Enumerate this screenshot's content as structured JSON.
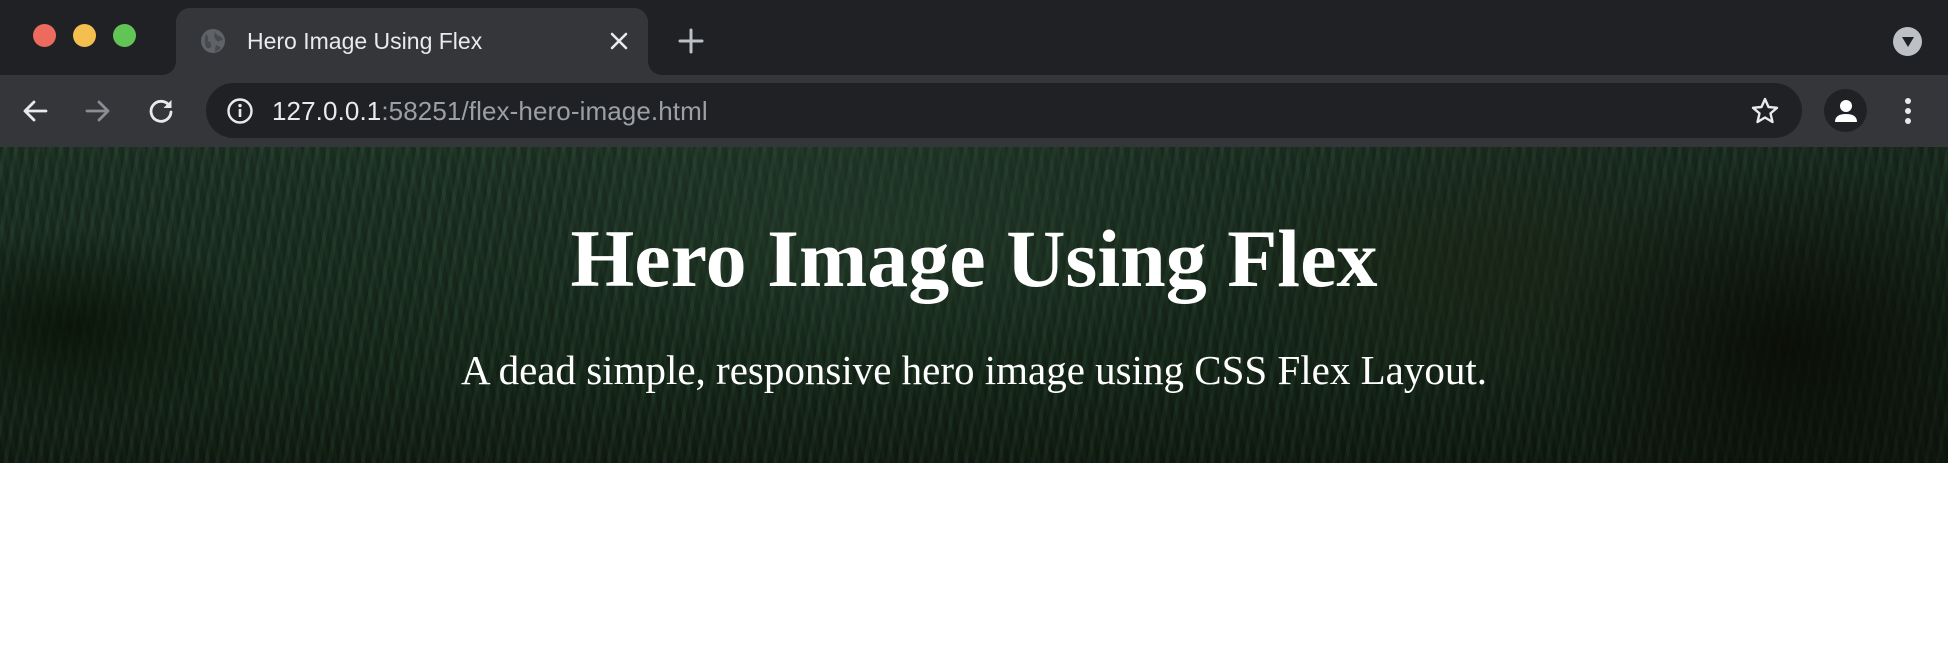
{
  "window": {
    "controls": [
      "close",
      "minimize",
      "maximize"
    ]
  },
  "tabs": [
    {
      "title": "Hero Image Using Flex",
      "favicon": "globe-icon",
      "active": true
    }
  ],
  "toolbar": {
    "url_host": "127.0.0.1",
    "url_rest": ":58251/flex-hero-image.html",
    "icons": {
      "back": "arrow-left-icon",
      "forward": "arrow-right-icon",
      "reload": "reload-icon",
      "info": "info-icon",
      "bookmark": "star-icon",
      "profile": "person-icon",
      "menu": "kebab-menu-icon"
    }
  },
  "page": {
    "hero": {
      "title": "Hero Image Using Flex",
      "subtitle": "A dead simple, responsive hero image using CSS Flex Layout."
    }
  },
  "colors": {
    "titlebar": "#202124",
    "toolbar": "#35363a",
    "omnibox": "#202124",
    "close_red": "#ed6a5e",
    "minimize_yellow": "#f4bf4f",
    "maximize_green": "#61c454",
    "hero_text": "#ffffff"
  }
}
